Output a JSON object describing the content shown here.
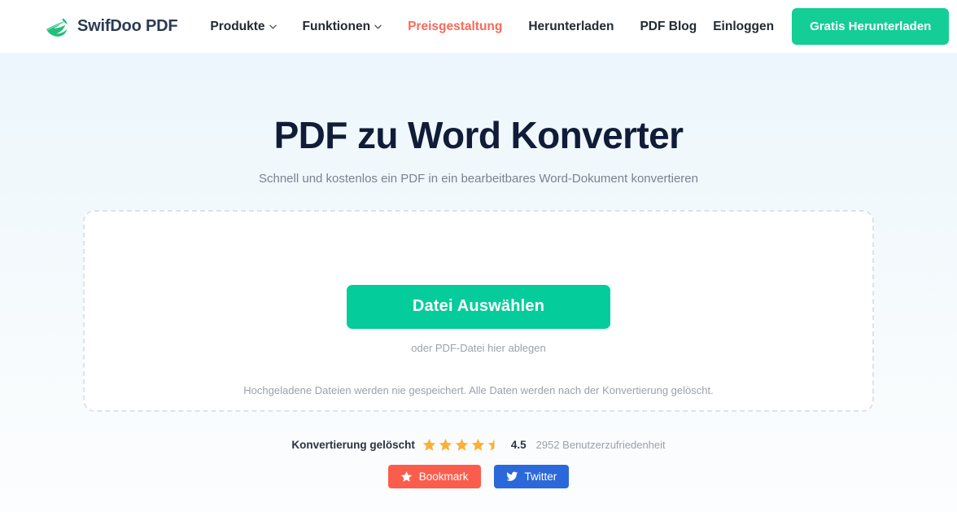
{
  "header": {
    "brand": {
      "name": "SwifDoo PDF",
      "logo_icon": "swallow-bird-logo"
    },
    "nav": [
      {
        "label": "Produkte",
        "icon": "chevron-down-icon",
        "has_caret": true,
        "accent": false
      },
      {
        "label": "Funktionen",
        "icon": "chevron-down-icon",
        "has_caret": true,
        "accent": false
      },
      {
        "label": "Preisgestaltung",
        "icon": "",
        "has_caret": false,
        "accent": true
      },
      {
        "label": "Herunterladen",
        "icon": "",
        "has_caret": false,
        "accent": false
      },
      {
        "label": "PDF Blog",
        "icon": "",
        "has_caret": false,
        "accent": false
      }
    ],
    "login_label": "Einloggen",
    "cta_label": "Gratis Herunterladen",
    "cta_color": "#14ce95",
    "accent_color": "#fa6a5a"
  },
  "hero": {
    "title": "PDF zu Word Konverter",
    "subtitle": "Schnell und kostenlos ein PDF in ein bearbeitbares Word-Dokument konvertieren"
  },
  "dropzone": {
    "select_button_label": "Datei Auswählen",
    "select_button_color": "#05cc9b",
    "drop_hint": "oder PDF-Datei hier ablegen",
    "privacy_note": "Hochgeladene Dateien werden nie gespeichert. Alle Daten werden nach der Konvertierung gelöscht."
  },
  "rating": {
    "label": "Konvertierung gelöscht",
    "score": "4.5",
    "stars_full": 4,
    "stars_half": 1,
    "star_color": "#fab037",
    "count_text": "2952 Benutzerzufriedenheit"
  },
  "share": {
    "bookmark": {
      "label": "Bookmark",
      "icon": "star-icon",
      "color": "#fb5d4d"
    },
    "twitter": {
      "label": "Twitter",
      "icon": "twitter-bird-icon",
      "color": "#2b68d9"
    }
  }
}
